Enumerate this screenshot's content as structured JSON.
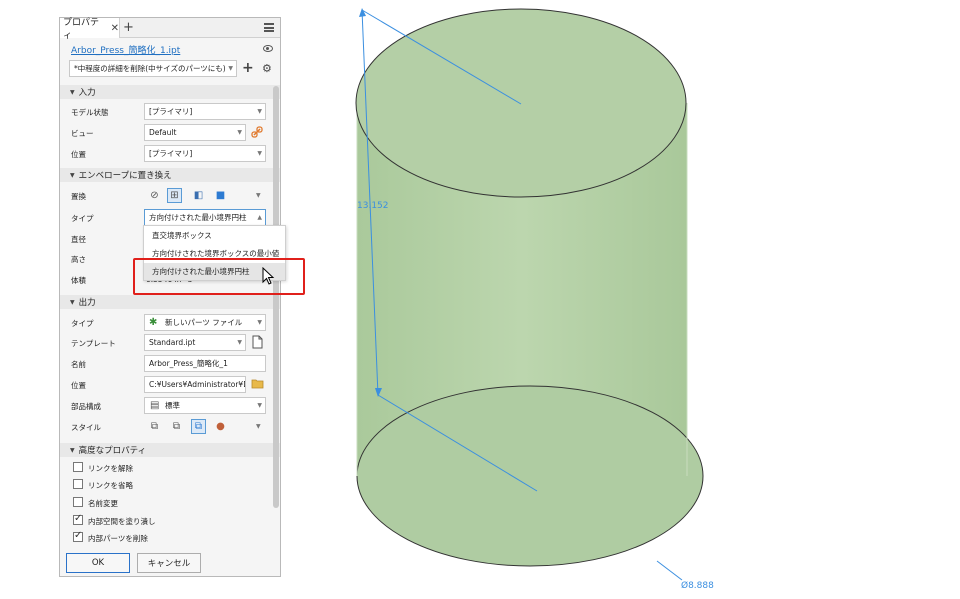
{
  "panel": {
    "tab_label": "プロパティ",
    "close_glyph": "✕",
    "add_tab_glyph": "+",
    "file_name": "Arbor_Press_簡略化_1.ipt",
    "preset_value": "*中程度の詳細を削除(中サイズのパーツにも)",
    "preset_add_glyph": "+",
    "settings_glyph": "⚙"
  },
  "input_section": {
    "title": "入力",
    "model_state_label": "モデル状態",
    "model_state_value": "[プライマリ]",
    "view_label": "ビュー",
    "view_value": "Default",
    "position_label": "位置",
    "position_value": "[プライマリ]"
  },
  "envelope_section": {
    "title": "エンベロープに置き換え",
    "replace_label": "置換",
    "type_label": "タイプ",
    "type_value": "方向付けされた最小境界円柱",
    "diameter_label": "直径",
    "height_label": "高さ",
    "volume_label": "体積",
    "volume_value": "0.5546 in^3"
  },
  "type_dropdown": {
    "options": [
      "直交境界ボックス",
      "方向付けされた境界ボックスの最小値",
      "方向付けされた最小境界円柱"
    ],
    "highlighted_index": 2
  },
  "output_section": {
    "title": "出力",
    "type_label": "タイプ",
    "type_value": "新しいパーツ ファイル",
    "template_label": "テンプレート",
    "template_value": "Standard.ipt",
    "name_label": "名前",
    "name_value": "Arbor_Press_簡略化_1",
    "location_label": "位置",
    "location_value": "C:¥Users¥Administrator¥Do",
    "bom_label": "部品構成",
    "bom_value": "標準",
    "style_label": "スタイル"
  },
  "advanced_section": {
    "title": "高度なプロパティ",
    "options": [
      {
        "label": "リンクを解除",
        "checked": false
      },
      {
        "label": "リンクを省略",
        "checked": false
      },
      {
        "label": "名前変更",
        "checked": false
      },
      {
        "label": "内部空間を塗り潰し",
        "checked": true
      },
      {
        "label": "内部パーツを削除",
        "checked": true
      }
    ]
  },
  "buttons": {
    "ok": "OK",
    "cancel": "キャンセル"
  },
  "viewport": {
    "cylinder_fill": "#b4cfa6",
    "dimension_color": "#3b8fe0",
    "height_dimension": "13.152",
    "diameter_dimension": "Ø8.888"
  }
}
